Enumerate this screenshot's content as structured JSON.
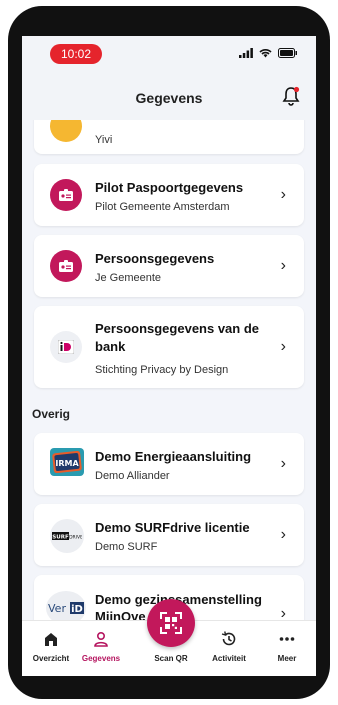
{
  "status_bar": {
    "time": "10:02"
  },
  "header": {
    "title": "Gegevens"
  },
  "cards": [
    {
      "title": "",
      "subtitle": "Yivi",
      "icon": "yivi-icon"
    },
    {
      "title": "Pilot Paspoortgegevens",
      "subtitle": "Pilot Gemeente Amsterdam",
      "icon": "id-card-icon"
    },
    {
      "title": "Persoonsgegevens",
      "subtitle": "Je Gemeente",
      "icon": "id-card-icon"
    },
    {
      "title": "Persoonsgegevens van de bank",
      "subtitle": "Stichting Privacy by Design",
      "icon": "ideal-icon"
    }
  ],
  "section_other": {
    "label": "Overig"
  },
  "other_cards": [
    {
      "title": "Demo Energieaansluiting",
      "subtitle": "Demo Alliander",
      "icon": "irma-logo-icon"
    },
    {
      "title": "Demo SURFdrive licentie",
      "subtitle": "Demo SURF",
      "icon": "surfdrive-logo-icon",
      "logo_text": "SURF DRIVE"
    },
    {
      "title": "Demo gezinssamenstelling",
      "subtitle": "MijnOve",
      "icon": "verid-logo-icon",
      "logo_text": "VerID"
    }
  ],
  "bottom_nav": {
    "items": [
      {
        "label": "Overzicht",
        "icon": "home-icon"
      },
      {
        "label": "Gegevens",
        "icon": "person-icon",
        "active": true
      },
      {
        "label": "Scan QR",
        "icon": "qr-icon"
      },
      {
        "label": "Activiteit",
        "icon": "history-icon"
      },
      {
        "label": "Meer",
        "icon": "more-icon"
      }
    ]
  },
  "colors": {
    "accent": "#c2185b",
    "time_pill": "#e5242c",
    "background": "#f3f5fa"
  }
}
